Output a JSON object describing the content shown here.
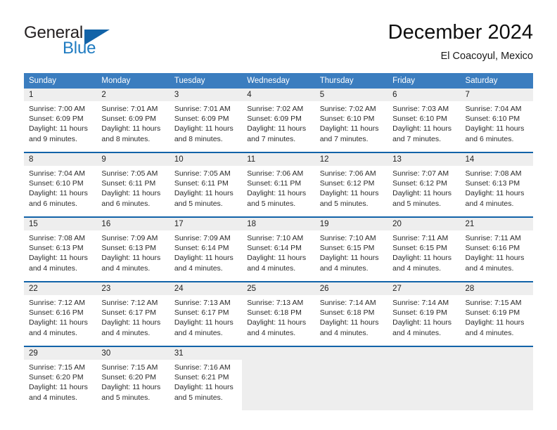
{
  "brand": {
    "name_part1": "General",
    "name_part2": "Blue",
    "logo_icon": "blue-triangle-logo-icon"
  },
  "header": {
    "title": "December 2024",
    "subtitle": "El Coacoyul, Mexico"
  },
  "colors": {
    "header_blue": "#3b7dbf",
    "brand_blue": "#1f7bc1",
    "logo_blue": "#1263a8",
    "daynum_bg": "#eeeeee",
    "separator_blue": "#1263a8",
    "text_dark": "#2b2b2b"
  },
  "weekdays": [
    "Sunday",
    "Monday",
    "Tuesday",
    "Wednesday",
    "Thursday",
    "Friday",
    "Saturday"
  ],
  "weeks": [
    [
      {
        "day": "1",
        "sunrise": "Sunrise: 7:00 AM",
        "sunset": "Sunset: 6:09 PM",
        "daylight_line1": "Daylight: 11 hours",
        "daylight_line2": "and 9 minutes."
      },
      {
        "day": "2",
        "sunrise": "Sunrise: 7:01 AM",
        "sunset": "Sunset: 6:09 PM",
        "daylight_line1": "Daylight: 11 hours",
        "daylight_line2": "and 8 minutes."
      },
      {
        "day": "3",
        "sunrise": "Sunrise: 7:01 AM",
        "sunset": "Sunset: 6:09 PM",
        "daylight_line1": "Daylight: 11 hours",
        "daylight_line2": "and 8 minutes."
      },
      {
        "day": "4",
        "sunrise": "Sunrise: 7:02 AM",
        "sunset": "Sunset: 6:09 PM",
        "daylight_line1": "Daylight: 11 hours",
        "daylight_line2": "and 7 minutes."
      },
      {
        "day": "5",
        "sunrise": "Sunrise: 7:02 AM",
        "sunset": "Sunset: 6:10 PM",
        "daylight_line1": "Daylight: 11 hours",
        "daylight_line2": "and 7 minutes."
      },
      {
        "day": "6",
        "sunrise": "Sunrise: 7:03 AM",
        "sunset": "Sunset: 6:10 PM",
        "daylight_line1": "Daylight: 11 hours",
        "daylight_line2": "and 7 minutes."
      },
      {
        "day": "7",
        "sunrise": "Sunrise: 7:04 AM",
        "sunset": "Sunset: 6:10 PM",
        "daylight_line1": "Daylight: 11 hours",
        "daylight_line2": "and 6 minutes."
      }
    ],
    [
      {
        "day": "8",
        "sunrise": "Sunrise: 7:04 AM",
        "sunset": "Sunset: 6:10 PM",
        "daylight_line1": "Daylight: 11 hours",
        "daylight_line2": "and 6 minutes."
      },
      {
        "day": "9",
        "sunrise": "Sunrise: 7:05 AM",
        "sunset": "Sunset: 6:11 PM",
        "daylight_line1": "Daylight: 11 hours",
        "daylight_line2": "and 6 minutes."
      },
      {
        "day": "10",
        "sunrise": "Sunrise: 7:05 AM",
        "sunset": "Sunset: 6:11 PM",
        "daylight_line1": "Daylight: 11 hours",
        "daylight_line2": "and 5 minutes."
      },
      {
        "day": "11",
        "sunrise": "Sunrise: 7:06 AM",
        "sunset": "Sunset: 6:11 PM",
        "daylight_line1": "Daylight: 11 hours",
        "daylight_line2": "and 5 minutes."
      },
      {
        "day": "12",
        "sunrise": "Sunrise: 7:06 AM",
        "sunset": "Sunset: 6:12 PM",
        "daylight_line1": "Daylight: 11 hours",
        "daylight_line2": "and 5 minutes."
      },
      {
        "day": "13",
        "sunrise": "Sunrise: 7:07 AM",
        "sunset": "Sunset: 6:12 PM",
        "daylight_line1": "Daylight: 11 hours",
        "daylight_line2": "and 5 minutes."
      },
      {
        "day": "14",
        "sunrise": "Sunrise: 7:08 AM",
        "sunset": "Sunset: 6:13 PM",
        "daylight_line1": "Daylight: 11 hours",
        "daylight_line2": "and 4 minutes."
      }
    ],
    [
      {
        "day": "15",
        "sunrise": "Sunrise: 7:08 AM",
        "sunset": "Sunset: 6:13 PM",
        "daylight_line1": "Daylight: 11 hours",
        "daylight_line2": "and 4 minutes."
      },
      {
        "day": "16",
        "sunrise": "Sunrise: 7:09 AM",
        "sunset": "Sunset: 6:13 PM",
        "daylight_line1": "Daylight: 11 hours",
        "daylight_line2": "and 4 minutes."
      },
      {
        "day": "17",
        "sunrise": "Sunrise: 7:09 AM",
        "sunset": "Sunset: 6:14 PM",
        "daylight_line1": "Daylight: 11 hours",
        "daylight_line2": "and 4 minutes."
      },
      {
        "day": "18",
        "sunrise": "Sunrise: 7:10 AM",
        "sunset": "Sunset: 6:14 PM",
        "daylight_line1": "Daylight: 11 hours",
        "daylight_line2": "and 4 minutes."
      },
      {
        "day": "19",
        "sunrise": "Sunrise: 7:10 AM",
        "sunset": "Sunset: 6:15 PM",
        "daylight_line1": "Daylight: 11 hours",
        "daylight_line2": "and 4 minutes."
      },
      {
        "day": "20",
        "sunrise": "Sunrise: 7:11 AM",
        "sunset": "Sunset: 6:15 PM",
        "daylight_line1": "Daylight: 11 hours",
        "daylight_line2": "and 4 minutes."
      },
      {
        "day": "21",
        "sunrise": "Sunrise: 7:11 AM",
        "sunset": "Sunset: 6:16 PM",
        "daylight_line1": "Daylight: 11 hours",
        "daylight_line2": "and 4 minutes."
      }
    ],
    [
      {
        "day": "22",
        "sunrise": "Sunrise: 7:12 AM",
        "sunset": "Sunset: 6:16 PM",
        "daylight_line1": "Daylight: 11 hours",
        "daylight_line2": "and 4 minutes."
      },
      {
        "day": "23",
        "sunrise": "Sunrise: 7:12 AM",
        "sunset": "Sunset: 6:17 PM",
        "daylight_line1": "Daylight: 11 hours",
        "daylight_line2": "and 4 minutes."
      },
      {
        "day": "24",
        "sunrise": "Sunrise: 7:13 AM",
        "sunset": "Sunset: 6:17 PM",
        "daylight_line1": "Daylight: 11 hours",
        "daylight_line2": "and 4 minutes."
      },
      {
        "day": "25",
        "sunrise": "Sunrise: 7:13 AM",
        "sunset": "Sunset: 6:18 PM",
        "daylight_line1": "Daylight: 11 hours",
        "daylight_line2": "and 4 minutes."
      },
      {
        "day": "26",
        "sunrise": "Sunrise: 7:14 AM",
        "sunset": "Sunset: 6:18 PM",
        "daylight_line1": "Daylight: 11 hours",
        "daylight_line2": "and 4 minutes."
      },
      {
        "day": "27",
        "sunrise": "Sunrise: 7:14 AM",
        "sunset": "Sunset: 6:19 PM",
        "daylight_line1": "Daylight: 11 hours",
        "daylight_line2": "and 4 minutes."
      },
      {
        "day": "28",
        "sunrise": "Sunrise: 7:15 AM",
        "sunset": "Sunset: 6:19 PM",
        "daylight_line1": "Daylight: 11 hours",
        "daylight_line2": "and 4 minutes."
      }
    ],
    [
      {
        "day": "29",
        "sunrise": "Sunrise: 7:15 AM",
        "sunset": "Sunset: 6:20 PM",
        "daylight_line1": "Daylight: 11 hours",
        "daylight_line2": "and 4 minutes."
      },
      {
        "day": "30",
        "sunrise": "Sunrise: 7:15 AM",
        "sunset": "Sunset: 6:20 PM",
        "daylight_line1": "Daylight: 11 hours",
        "daylight_line2": "and 5 minutes."
      },
      {
        "day": "31",
        "sunrise": "Sunrise: 7:16 AM",
        "sunset": "Sunset: 6:21 PM",
        "daylight_line1": "Daylight: 11 hours",
        "daylight_line2": "and 5 minutes."
      },
      {
        "day": "",
        "sunrise": "",
        "sunset": "",
        "daylight_line1": "",
        "daylight_line2": ""
      },
      {
        "day": "",
        "sunrise": "",
        "sunset": "",
        "daylight_line1": "",
        "daylight_line2": ""
      },
      {
        "day": "",
        "sunrise": "",
        "sunset": "",
        "daylight_line1": "",
        "daylight_line2": ""
      },
      {
        "day": "",
        "sunrise": "",
        "sunset": "",
        "daylight_line1": "",
        "daylight_line2": ""
      }
    ]
  ]
}
